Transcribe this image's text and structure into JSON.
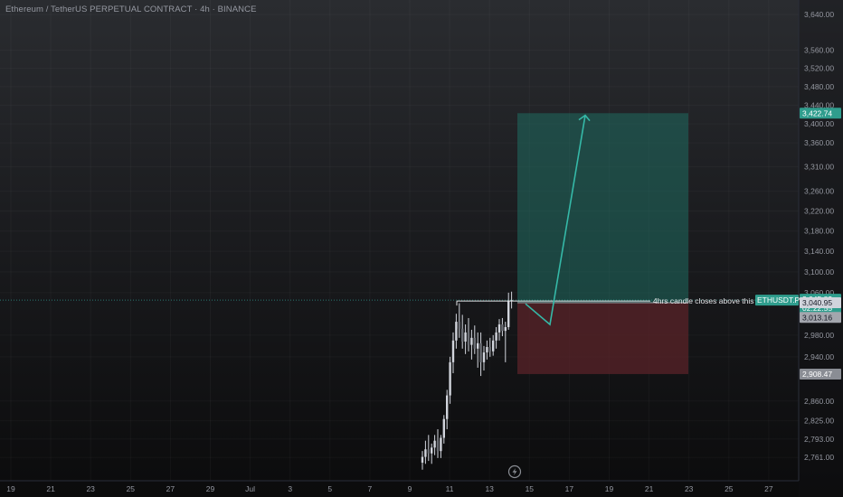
{
  "header": {
    "title": "Ethereum / TetherUS PERPETUAL CONTRACT · 4h · BINANCE"
  },
  "annotation": {
    "text": "4hrs candle closes above this"
  },
  "price_tags": {
    "symbol": "ETHUSDT.P",
    "last_price": "3,045.83",
    "countdown": "02:22:55",
    "entry": "3,040.95",
    "mid": "3,013.16",
    "stop": "2,908.47",
    "target": "3,422.74"
  },
  "colors": {
    "profit_zone": "#1f6b60",
    "loss_zone": "#5a2328",
    "candle": "#d1d4dc",
    "arrow": "#35b9a8",
    "target_badge": "#2f9d8d",
    "entry_badge": "#d1d4dc",
    "stop_badge": "#8a8d94",
    "last_price_badge": "#2f9d8d"
  },
  "icons": {
    "replay": "lightning-icon"
  },
  "chart_data": {
    "type": "candlestick",
    "title": "Ethereum / TetherUS PERPETUAL CONTRACT · 4h · BINANCE",
    "y_scale": "log",
    "ylim": [
      2735,
      3665
    ],
    "y_ticks": [
      {
        "value": 3640,
        "label": "3,640.00"
      },
      {
        "value": 3560,
        "label": "3,560.00"
      },
      {
        "value": 3520,
        "label": "3,520.00"
      },
      {
        "value": 3480,
        "label": "3,480.00"
      },
      {
        "value": 3440,
        "label": "3,440.00"
      },
      {
        "value": 3400,
        "label": "3,400.00"
      },
      {
        "value": 3360,
        "label": "3,360.00"
      },
      {
        "value": 3310,
        "label": "3,310.00"
      },
      {
        "value": 3260,
        "label": "3,260.00"
      },
      {
        "value": 3220,
        "label": "3,220.00"
      },
      {
        "value": 3180,
        "label": "3,180.00"
      },
      {
        "value": 3140,
        "label": "3,140.00"
      },
      {
        "value": 3100,
        "label": "3,100.00"
      },
      {
        "value": 3060,
        "label": "3,060.00"
      },
      {
        "value": 2980,
        "label": "2,980.00"
      },
      {
        "value": 2940,
        "label": "2,940.00"
      },
      {
        "value": 2860,
        "label": "2,860.00"
      },
      {
        "value": 2825,
        "label": "2,825.00"
      },
      {
        "value": 2793,
        "label": "2,793.00"
      },
      {
        "value": 2761,
        "label": "2,761.00"
      }
    ],
    "x_ticks": [
      "19",
      "21",
      "23",
      "25",
      "27",
      "29",
      "Jul",
      "3",
      "5",
      "7",
      "9",
      "11",
      "13",
      "15",
      "17",
      "19",
      "21",
      "23",
      "25",
      "27"
    ],
    "candles": [
      {
        "o": 2752,
        "h": 2772,
        "l": 2740,
        "c": 2762
      },
      {
        "o": 2762,
        "h": 2790,
        "l": 2750,
        "c": 2775
      },
      {
        "o": 2775,
        "h": 2800,
        "l": 2755,
        "c": 2768
      },
      {
        "o": 2768,
        "h": 2785,
        "l": 2750,
        "c": 2778
      },
      {
        "o": 2778,
        "h": 2800,
        "l": 2765,
        "c": 2790
      },
      {
        "o": 2790,
        "h": 2810,
        "l": 2760,
        "c": 2772
      },
      {
        "o": 2772,
        "h": 2800,
        "l": 2760,
        "c": 2795
      },
      {
        "o": 2795,
        "h": 2835,
        "l": 2785,
        "c": 2828
      },
      {
        "o": 2828,
        "h": 2880,
        "l": 2810,
        "c": 2870
      },
      {
        "o": 2870,
        "h": 2940,
        "l": 2855,
        "c": 2930
      },
      {
        "o": 2930,
        "h": 2985,
        "l": 2910,
        "c": 2970
      },
      {
        "o": 2970,
        "h": 3020,
        "l": 2955,
        "c": 3005
      },
      {
        "o": 3005,
        "h": 3040,
        "l": 2975,
        "c": 2992
      },
      {
        "o": 2992,
        "h": 3018,
        "l": 2955,
        "c": 2968
      },
      {
        "o": 2968,
        "h": 3000,
        "l": 2945,
        "c": 2985
      },
      {
        "o": 2985,
        "h": 3012,
        "l": 2950,
        "c": 2962
      },
      {
        "o": 2962,
        "h": 2990,
        "l": 2935,
        "c": 2975
      },
      {
        "o": 2975,
        "h": 2998,
        "l": 2945,
        "c": 2955
      },
      {
        "o": 2955,
        "h": 2985,
        "l": 2920,
        "c": 2965
      },
      {
        "o": 2965,
        "h": 2985,
        "l": 2905,
        "c": 2930
      },
      {
        "o": 2930,
        "h": 2960,
        "l": 2915,
        "c": 2948
      },
      {
        "o": 2948,
        "h": 2970,
        "l": 2935,
        "c": 2958
      },
      {
        "o": 2958,
        "h": 2975,
        "l": 2940,
        "c": 2950
      },
      {
        "o": 2950,
        "h": 2980,
        "l": 2942,
        "c": 2970
      },
      {
        "o": 2970,
        "h": 2995,
        "l": 2955,
        "c": 2985
      },
      {
        "o": 2985,
        "h": 3010,
        "l": 2970,
        "c": 3000
      },
      {
        "o": 3000,
        "h": 3012,
        "l": 2978,
        "c": 2988
      },
      {
        "o": 2988,
        "h": 3005,
        "l": 2930,
        "c": 2995
      },
      {
        "o": 2995,
        "h": 3060,
        "l": 2990,
        "c": 3045
      },
      {
        "o": 3045,
        "h": 3062,
        "l": 3030,
        "c": 3045.83
      }
    ],
    "position": {
      "entry": 3040.95,
      "target": 3422.74,
      "stop": 2908.47
    },
    "annotation_level": 3045.83,
    "arrow_path_prices": [
      3044,
      3010,
      3422
    ]
  }
}
